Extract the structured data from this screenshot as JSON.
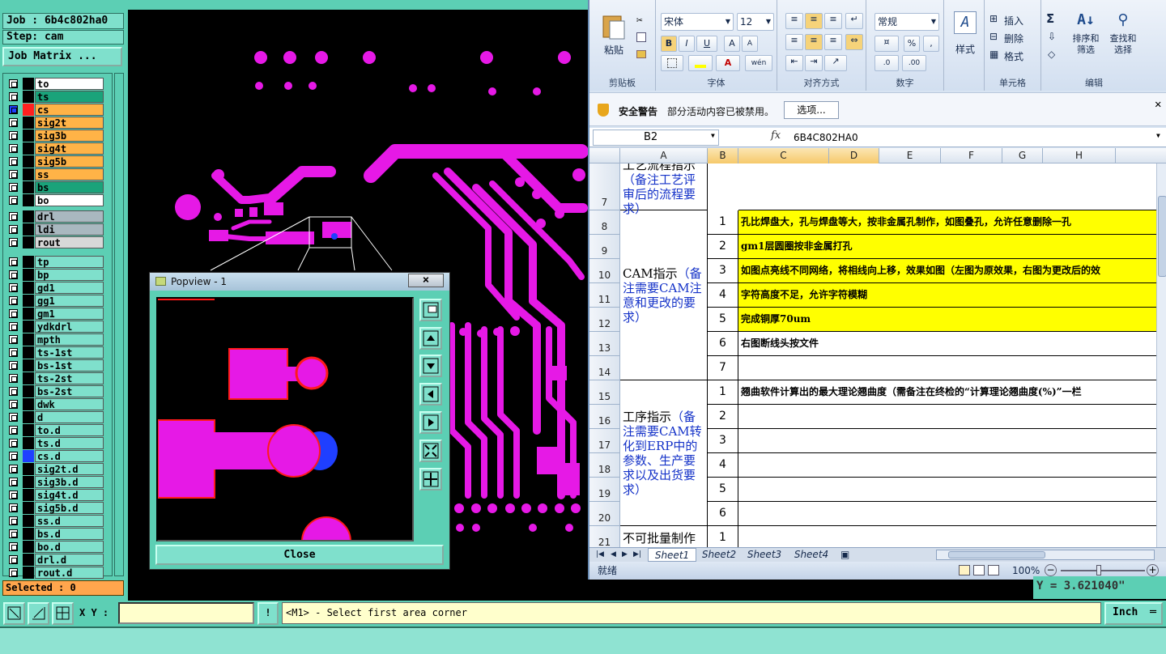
{
  "cam": {
    "job_label": "Job : 6b4c802ha0",
    "step_label": "Step: cam",
    "job_matrix": "Job Matrix ...",
    "selected": "Selected : 0",
    "layers": [
      {
        "name": "to",
        "bg": "#ffffff",
        "color": "#000000"
      },
      {
        "name": "ts",
        "bg": "#1aa37a",
        "color": "#000000"
      },
      {
        "name": "cs",
        "bg": "#ffb347",
        "color": "#ff2020",
        "active": true
      },
      {
        "name": "sig2t",
        "bg": "#ffb347",
        "color": "#000000"
      },
      {
        "name": "sig3b",
        "bg": "#ffb347",
        "color": "#000000"
      },
      {
        "name": "sig4t",
        "bg": "#ffb347",
        "color": "#000000"
      },
      {
        "name": "sig5b",
        "bg": "#ffb347",
        "color": "#000000"
      },
      {
        "name": "ss",
        "bg": "#ffb347",
        "color": "#000000"
      },
      {
        "name": "bs",
        "bg": "#1aa37a",
        "color": "#000000"
      },
      {
        "name": "bo",
        "bg": "#ffffff",
        "color": "#000000"
      },
      {
        "name": "drl",
        "bg": "#a9b8bf",
        "color": "#000000"
      },
      {
        "name": "ldi",
        "bg": "#a9b8bf",
        "color": "#000000"
      },
      {
        "name": "rout",
        "bg": "#d8d8d8",
        "color": "#000000"
      },
      {
        "name": "tp",
        "bg": "#7fe0cc",
        "color": "#000000"
      },
      {
        "name": "bp",
        "bg": "#7fe0cc",
        "color": "#000000"
      },
      {
        "name": "gd1",
        "bg": "#7fe0cc",
        "color": "#000000"
      },
      {
        "name": "gg1",
        "bg": "#7fe0cc",
        "color": "#000000"
      },
      {
        "name": "gm1",
        "bg": "#7fe0cc",
        "color": "#000000"
      },
      {
        "name": "ydkdrl",
        "bg": "#7fe0cc",
        "color": "#000000"
      },
      {
        "name": "mpth",
        "bg": "#7fe0cc",
        "color": "#000000"
      },
      {
        "name": "ts-1st",
        "bg": "#7fe0cc",
        "color": "#000000"
      },
      {
        "name": "bs-1st",
        "bg": "#7fe0cc",
        "color": "#000000"
      },
      {
        "name": "ts-2st",
        "bg": "#7fe0cc",
        "color": "#000000"
      },
      {
        "name": "bs-2st",
        "bg": "#7fe0cc",
        "color": "#000000"
      },
      {
        "name": "dwk",
        "bg": "#7fe0cc",
        "color": "#000000"
      },
      {
        "name": "d",
        "bg": "#7fe0cc",
        "color": "#000000"
      },
      {
        "name": "to.d",
        "bg": "#7fe0cc",
        "color": "#000000"
      },
      {
        "name": "ts.d",
        "bg": "#7fe0cc",
        "color": "#000000"
      },
      {
        "name": "cs.d",
        "bg": "#7fe0cc",
        "color": "#1f3fff"
      },
      {
        "name": "sig2t.d",
        "bg": "#7fe0cc",
        "color": "#000000"
      },
      {
        "name": "sig3b.d",
        "bg": "#7fe0cc",
        "color": "#000000"
      },
      {
        "name": "sig4t.d",
        "bg": "#7fe0cc",
        "color": "#000000"
      },
      {
        "name": "sig5b.d",
        "bg": "#7fe0cc",
        "color": "#000000"
      },
      {
        "name": "ss.d",
        "bg": "#7fe0cc",
        "color": "#000000"
      },
      {
        "name": "bs.d",
        "bg": "#7fe0cc",
        "color": "#000000"
      },
      {
        "name": "bo.d",
        "bg": "#7fe0cc",
        "color": "#000000"
      },
      {
        "name": "drl.d",
        "bg": "#7fe0cc",
        "color": "#000000"
      },
      {
        "name": "rout.d",
        "bg": "#7fe0cc",
        "color": "#000000"
      }
    ],
    "popview": {
      "title": "Popview - 1",
      "close_x": "×",
      "close": "Close"
    },
    "xy_label": "X Y :",
    "xy_value": "",
    "bang": "!",
    "prompt": "<M1> - Select first area corner",
    "unit": "Inch",
    "coord": "Y = 3.621040\"",
    "colors": {
      "trace": "#e619e6",
      "outline": "#ff1a1a",
      "blue_pad": "#1f3fff",
      "panel": "#5ccfb4"
    }
  },
  "excel": {
    "ribbon": {
      "paste": "粘贴",
      "clipboard": "剪贴板",
      "font_name": "宋体",
      "font_size": "12",
      "font_group": "字体",
      "align_group": "对齐方式",
      "number_format": "常规",
      "number_group": "数字",
      "percent": "%",
      "comma": ",",
      "style": "样式",
      "insert": "插入",
      "delete": "删除",
      "format": "格式",
      "cells_group": "单元格",
      "sum": "Σ",
      "sort": "排序和筛选",
      "find": "查找和选择",
      "edit_group": "编辑",
      "bold": "B",
      "italic": "I",
      "underline": "U"
    },
    "security_title": "安全警告",
    "security_msg": "部分活动内容已被禁用。",
    "security_btn": "选项...",
    "name_box": "B2",
    "fx": "fx",
    "formula": "6B4C802HA0",
    "columns": [
      "A",
      "B",
      "C",
      "D",
      "E",
      "F",
      "G",
      "H"
    ],
    "rows": [
      {
        "num": "7",
        "a": "工艺流程指示",
        "a_blue": "（备注工艺评审后的流程要求）"
      },
      {
        "num": "8",
        "b": "1",
        "c": "孔比焊盘大，孔与焊盘等大，按非金属孔制作，如图叠孔，允许任意删除一孔",
        "yellow": true
      },
      {
        "num": "9",
        "b": "2",
        "c": "gm1层圆圈按非金属打孔",
        "yellow": true
      },
      {
        "num": "10",
        "a": "CAM指示",
        "a_blue": "（备注需要CAM注意和更改的要求）",
        "b": "3",
        "c": "如图点亮线不同网络，将相线向上移，效果如图（左图为原效果，右图为更改后的效",
        "yellow": true
      },
      {
        "num": "11",
        "b": "4",
        "c": "字符高度不足，允许字符模糊",
        "yellow": true
      },
      {
        "num": "12",
        "b": "5",
        "c": "完成铜厚70um",
        "yellow": true
      },
      {
        "num": "13",
        "b": "6",
        "c": "右图断线头按文件"
      },
      {
        "num": "14",
        "b": "7",
        "c": ""
      },
      {
        "num": "15",
        "b": "1",
        "c": "翘曲软件计算出的最大理论翘曲度（需备注在终检的“计算理论翘曲度(%)”一栏"
      },
      {
        "num": "16",
        "a": "工序指示",
        "a_blue": "（备注需要CAM转化到ERP中的参数、生产要求以及出货要求）",
        "b": "2",
        "c": ""
      },
      {
        "num": "17",
        "b": "3",
        "c": ""
      },
      {
        "num": "18",
        "b": "4",
        "c": ""
      },
      {
        "num": "19",
        "b": "5",
        "c": ""
      },
      {
        "num": "20",
        "b": "6",
        "c": ""
      },
      {
        "num": "21",
        "a": "不可批量制作",
        "b": "1",
        "c": ""
      }
    ],
    "sheets": [
      "Sheet1",
      "Sheet2",
      "Sheet3",
      "Sheet4"
    ],
    "status": "就绪",
    "zoom": "100%"
  }
}
